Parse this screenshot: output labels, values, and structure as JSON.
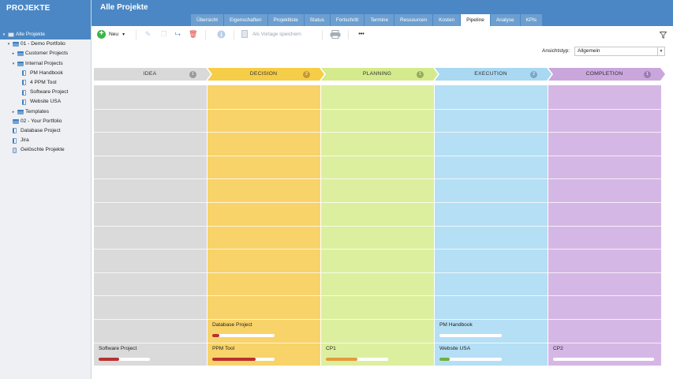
{
  "sidebar": {
    "title": "PROJEKTE",
    "items": [
      {
        "label": "Alle Projekte",
        "level": 0,
        "toggle": "▾",
        "icon": "root",
        "selected": true
      },
      {
        "label": "01 - Demo Portfolio",
        "level": 1,
        "toggle": "▾",
        "icon": "folder"
      },
      {
        "label": "Customer Projects",
        "level": 2,
        "toggle": "▸",
        "icon": "folder"
      },
      {
        "label": "Internal Projects",
        "level": 2,
        "toggle": "▾",
        "icon": "folder"
      },
      {
        "label": "PM Handbook",
        "level": 3,
        "toggle": "",
        "icon": "page"
      },
      {
        "label": "4 PPM Tool",
        "level": 3,
        "toggle": "",
        "icon": "page"
      },
      {
        "label": "Software Project",
        "level": 3,
        "toggle": "",
        "icon": "page"
      },
      {
        "label": "Website USA",
        "level": 3,
        "toggle": "",
        "icon": "page"
      },
      {
        "label": "Templates",
        "level": 2,
        "toggle": "▸",
        "icon": "folder"
      },
      {
        "label": "02 - Your Portfolio",
        "level": 1,
        "toggle": "",
        "icon": "folder"
      },
      {
        "label": "Database Project",
        "level": 1,
        "toggle": "",
        "icon": "page"
      },
      {
        "label": "Jira",
        "level": 1,
        "toggle": "",
        "icon": "page"
      },
      {
        "label": "Gelöschte Projekte",
        "level": 1,
        "toggle": "",
        "icon": "trash"
      }
    ]
  },
  "header": {
    "title": "Alle Projekte",
    "tabs": [
      {
        "label": "Übersicht"
      },
      {
        "label": "Eigenschaften"
      },
      {
        "label": "Projektliste"
      },
      {
        "label": "Status"
      },
      {
        "label": "Fortschritt"
      },
      {
        "label": "Termine"
      },
      {
        "label": "Ressourcen"
      },
      {
        "label": "Kosten"
      },
      {
        "label": "Pipeline",
        "active": true
      },
      {
        "label": "Analyse"
      },
      {
        "label": "KPIs"
      }
    ]
  },
  "toolbar": {
    "new_label": "Neu",
    "save_template_label": "Als Vorlage speichern",
    "more_label": "•••"
  },
  "view": {
    "label": "Ansichtstyp:",
    "value": "Allgemein"
  },
  "pipeline": {
    "stages": [
      {
        "name": "IDEA",
        "count": "1",
        "color": "#d9d9d9",
        "body": "#dadada",
        "badge": "#9a9a9a",
        "cards": [
          {
            "name": "Software Project",
            "progress": 0.4,
            "bar": "#b8312f",
            "slot": 11
          }
        ]
      },
      {
        "name": "DECISION",
        "count": "2",
        "color": "#f6cd47",
        "body": "#f8d36a",
        "badge": "#c49a2a",
        "cards": [
          {
            "name": "Database Project",
            "progress": 0.12,
            "bar": "#b8312f",
            "slot": 10
          },
          {
            "name": "PPM Tool",
            "progress": 0.7,
            "bar": "#b8312f",
            "slot": 11
          }
        ]
      },
      {
        "name": "PLANNING",
        "count": "1",
        "color": "#d4ea8c",
        "body": "#dcef9f",
        "badge": "#96ad55",
        "cards": [
          {
            "name": "CP1",
            "progress": 0.5,
            "bar": "#e59a3a",
            "slot": 11
          }
        ]
      },
      {
        "name": "EXECUTION",
        "count": "2",
        "color": "#a9d8f2",
        "body": "#b5dff5",
        "badge": "#7aa8c4",
        "cards": [
          {
            "name": "PM Handbook",
            "progress": 0.0,
            "bar": "#4caf50",
            "slot": 10
          },
          {
            "name": "Website USA",
            "progress": 0.16,
            "bar": "#6fb23c",
            "slot": 11
          }
        ]
      },
      {
        "name": "COMPLETION",
        "count": "1",
        "color": "#c9a6dc",
        "body": "#d5b7e5",
        "badge": "#9c7db2",
        "cards": [
          {
            "name": "CP2",
            "progress": 0.0,
            "bar": "#9c7db2",
            "slot": 11
          }
        ]
      }
    ]
  }
}
